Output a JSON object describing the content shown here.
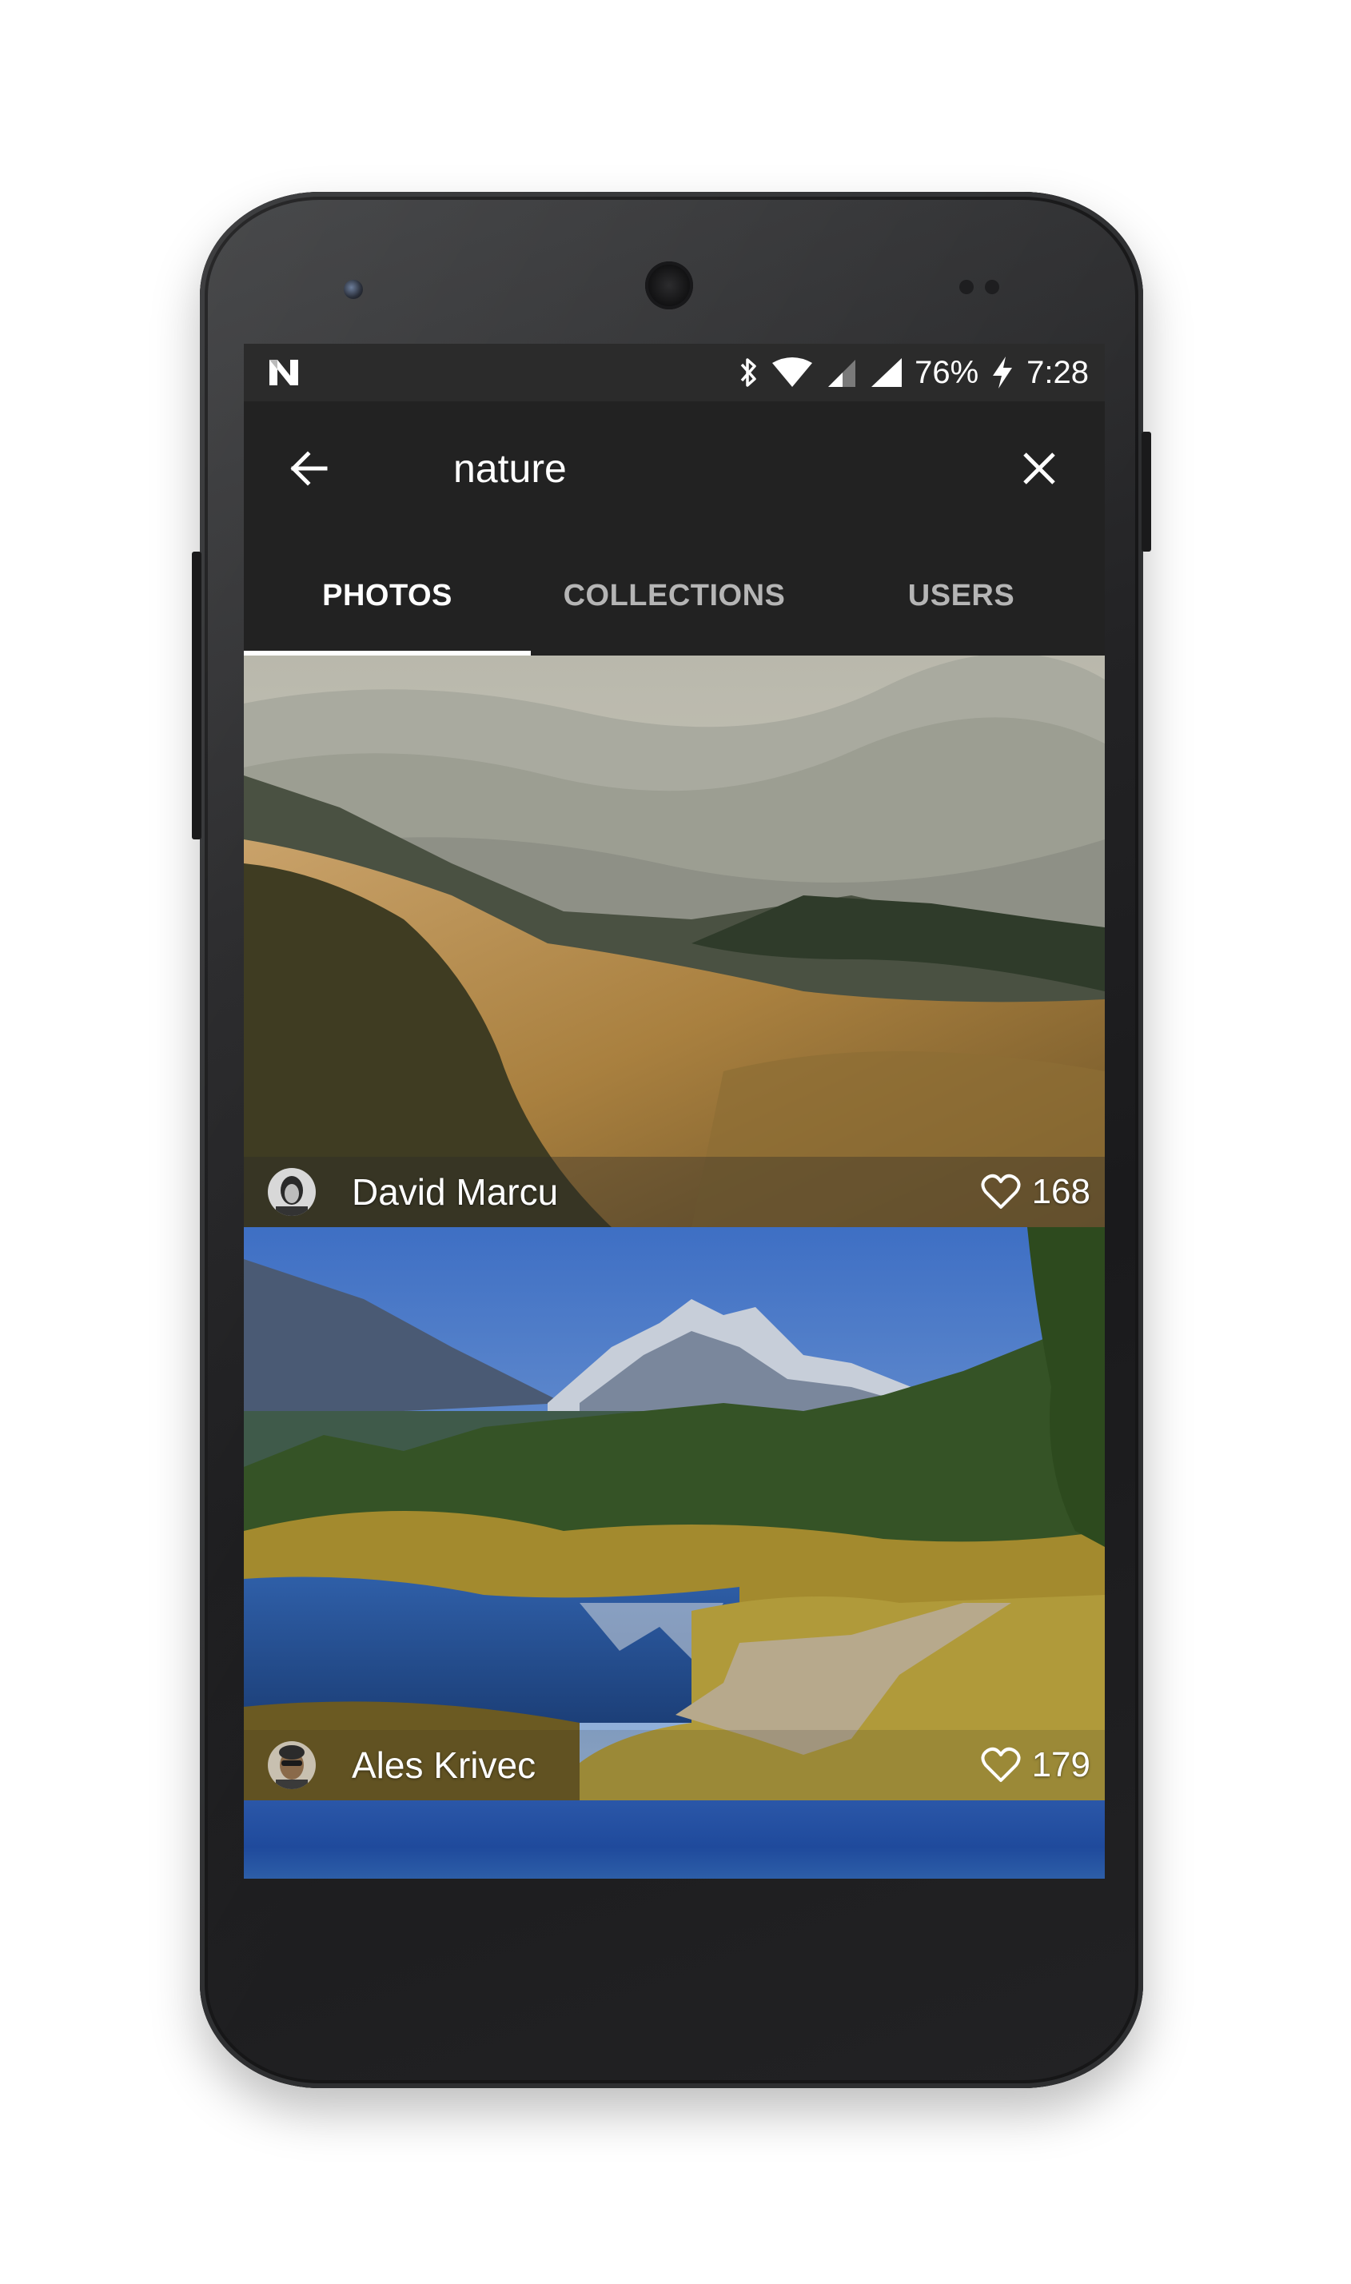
{
  "status_bar": {
    "battery": "76%",
    "time": "7:28",
    "icons": [
      "notification-n-icon",
      "bluetooth-icon",
      "wifi-icon",
      "cell-signal-icon",
      "cell-signal-icon",
      "battery-charging-icon"
    ]
  },
  "toolbar": {
    "search_query": "nature",
    "back_icon": "arrow-left-icon",
    "close_icon": "close-icon"
  },
  "tabs": [
    {
      "label": "PHOTOS",
      "active": true
    },
    {
      "label": "COLLECTIONS",
      "active": false
    },
    {
      "label": "USERS",
      "active": false
    }
  ],
  "photos": [
    {
      "author": "David Marcu",
      "likes": "168",
      "like_icon": "heart-outline-icon"
    },
    {
      "author": "Ales Krivec",
      "likes": "179",
      "like_icon": "heart-outline-icon"
    }
  ],
  "colors": {
    "toolbar": "#222222",
    "status_bar": "#2b2b2b",
    "tab_active": "#ffffff",
    "tab_inactive": "#b5b5b5"
  }
}
